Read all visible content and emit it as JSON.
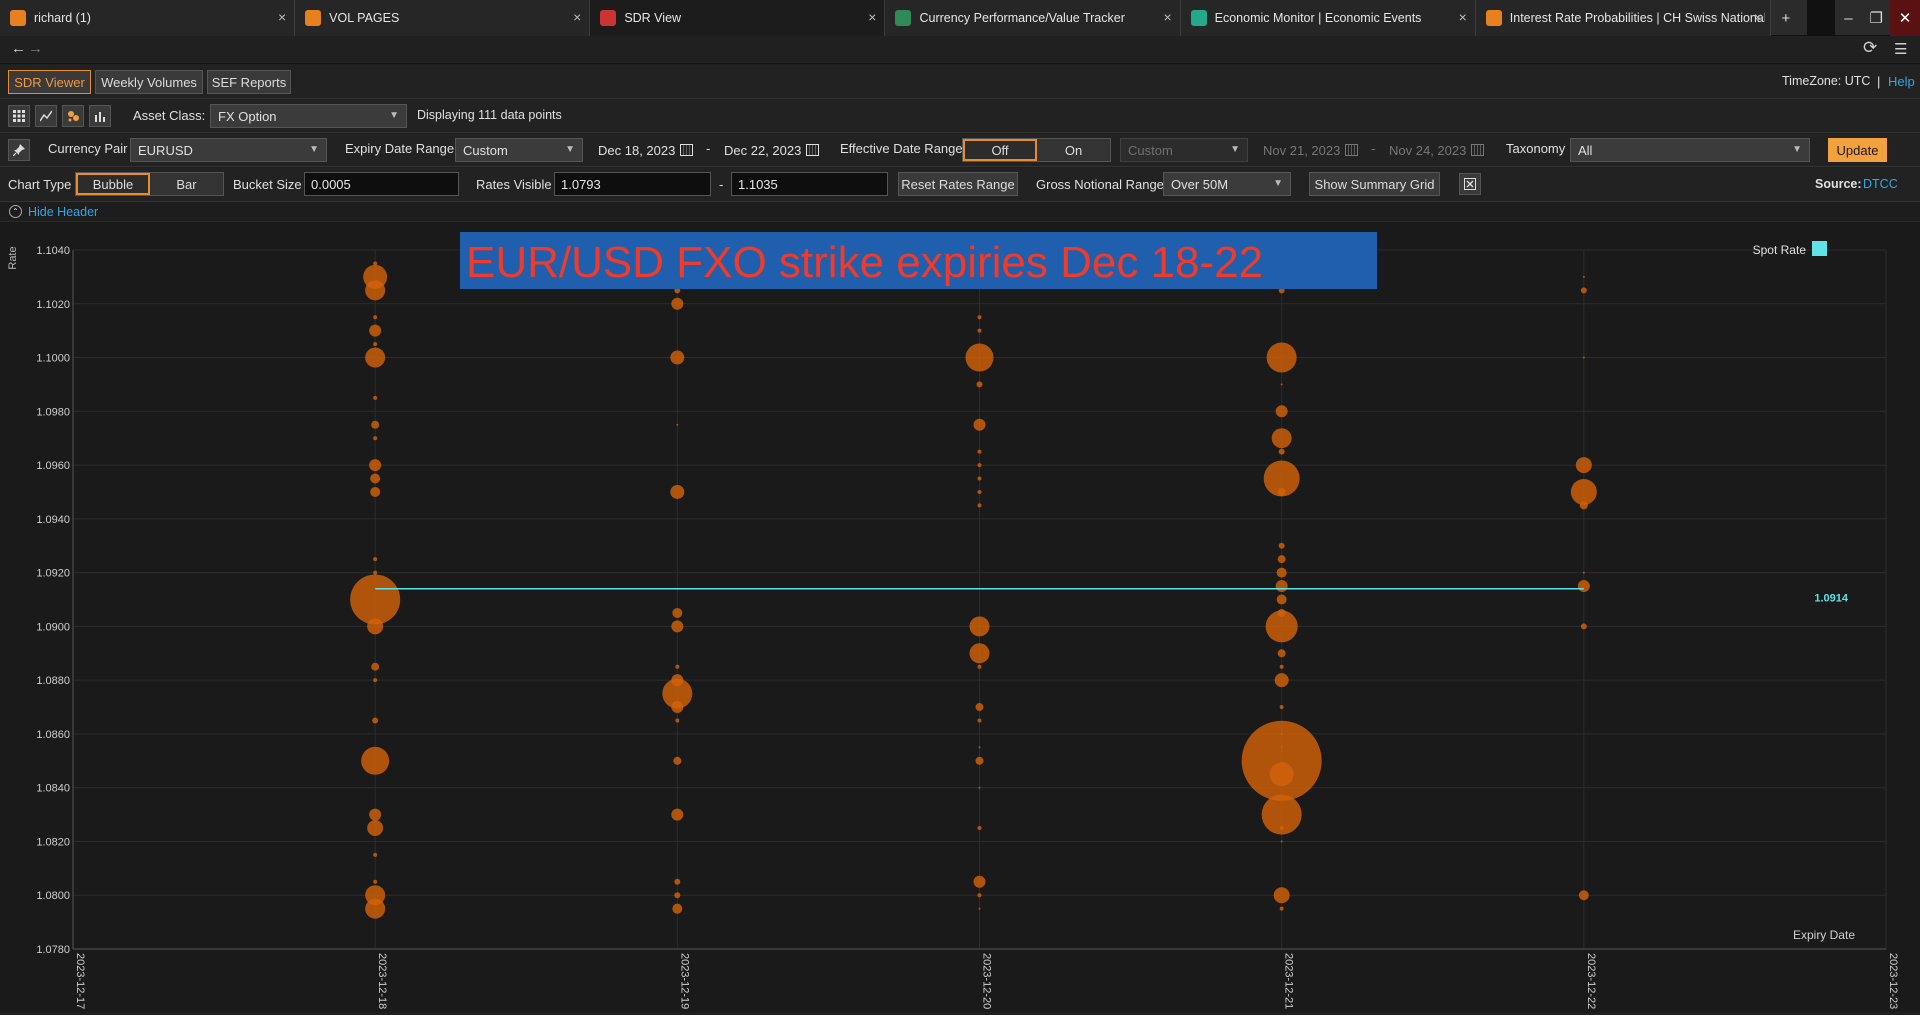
{
  "browser": {
    "tabs": [
      {
        "label": "richard (1)",
        "icon_color": "#e8801f",
        "active": false
      },
      {
        "label": "VOL PAGES",
        "icon_color": "#e8801f",
        "active": false
      },
      {
        "label": "SDR View",
        "icon_color": "#cc3333",
        "active": true
      },
      {
        "label": "Currency Performance/Value Tracker",
        "icon_color": "#2e8b57",
        "active": false
      },
      {
        "label": "Economic Monitor | Economic Events",
        "icon_color": "#22aa88",
        "active": false
      },
      {
        "label": "Interest Rate Probabilities | CH Swiss National B",
        "icon_color": "#e8801f",
        "active": false
      }
    ],
    "new_tab": "+",
    "minimize": "–",
    "restore": "❐",
    "close": "✕"
  },
  "nav": {
    "back": "←",
    "forward": "→",
    "refresh": "⟳",
    "menu": "☰"
  },
  "app_tabs": {
    "sdr_viewer": "SDR Viewer",
    "weekly_volumes": "Weekly Volumes",
    "sef_reports": "SEF Reports"
  },
  "header_right": {
    "timezone": "TimeZone: UTC",
    "separator": "|",
    "help": "Help"
  },
  "row_asset": {
    "asset_class_label": "Asset Class:",
    "asset_class_value": "FX Option",
    "displaying": "Displaying 111 data points"
  },
  "row_filters": {
    "currency_pair_label": "Currency Pair",
    "currency_pair_value": "EURUSD",
    "expiry_range_label": "Expiry Date Range",
    "expiry_range_value": "Custom",
    "expiry_from": "Dec 18, 2023",
    "dash": "-",
    "expiry_to": "Dec 22, 2023",
    "effective_label": "Effective Date Range",
    "effective_off": "Off",
    "effective_on": "On",
    "effective_value": "Custom",
    "effective_from": "Nov 21, 2023",
    "effective_to": "Nov 24, 2023",
    "taxonomy_label": "Taxonomy",
    "taxonomy_value": "All",
    "update": "Update"
  },
  "row_chart_opts": {
    "chart_type_label": "Chart Type",
    "bubble": "Bubble",
    "bar": "Bar",
    "bucket_label": "Bucket Size",
    "bucket_value": "0.0005",
    "rates_visible_label": "Rates Visible",
    "rates_min": "1.0793",
    "dash": "-",
    "rates_max": "1.1035",
    "reset_rates": "Reset Rates Range",
    "gross_notional_label": "Gross Notional Range",
    "gross_notional_value": "Over 50M",
    "summary_grid": "Show Summary Grid",
    "source_label": "Source:",
    "source_value": "DTCC"
  },
  "hide_header": "Hide Header",
  "chart_data": {
    "type": "scatter",
    "subtype": "bubble",
    "title": "EUR/USD FXO strike expiries Dec 18-22",
    "ylabel": "Rate",
    "xlabel": "Expiry Date",
    "ylim": [
      1.078,
      1.104
    ],
    "yticks": [
      "1.0780",
      "1.0800",
      "1.0820",
      "1.0840",
      "1.0860",
      "1.0880",
      "1.0900",
      "1.0920",
      "1.0940",
      "1.0960",
      "1.0980",
      "1.1000",
      "1.1020",
      "1.1040"
    ],
    "x_categories": [
      "2023-12-17",
      "2023-12-18",
      "2023-12-19",
      "2023-12-20",
      "2023-12-21",
      "2023-12-22",
      "2023-12-23"
    ],
    "legend": {
      "label": "Spot Rate",
      "position": "top-right",
      "color": "#5fe3e8"
    },
    "spot_rate": {
      "value": 1.0914,
      "label": "1.0914",
      "from": "2023-12-18",
      "to": "2023-12-22"
    },
    "bubble_color": "#d2620a",
    "series": [
      {
        "x": "2023-12-18",
        "points": [
          [
            1.1035,
            2
          ],
          [
            1.103,
            12
          ],
          [
            1.1025,
            10
          ],
          [
            1.1015,
            2
          ],
          [
            1.101,
            6
          ],
          [
            1.1005,
            2
          ],
          [
            1.1,
            10
          ],
          [
            1.0985,
            2
          ],
          [
            1.0975,
            4
          ],
          [
            1.097,
            2
          ],
          [
            1.096,
            6
          ],
          [
            1.0955,
            5
          ],
          [
            1.095,
            5
          ],
          [
            1.0925,
            2
          ],
          [
            1.092,
            2
          ],
          [
            1.091,
            25
          ],
          [
            1.09,
            8
          ],
          [
            1.0885,
            4
          ],
          [
            1.088,
            2
          ],
          [
            1.0865,
            3
          ],
          [
            1.085,
            14
          ],
          [
            1.083,
            6
          ],
          [
            1.0825,
            8
          ],
          [
            1.0815,
            2
          ],
          [
            1.0805,
            2
          ],
          [
            1.08,
            10
          ],
          [
            1.0795,
            10
          ]
        ]
      },
      {
        "x": "2023-12-19",
        "points": [
          [
            1.1025,
            3
          ],
          [
            1.102,
            6
          ],
          [
            1.1,
            7
          ],
          [
            1.0975,
            1
          ],
          [
            1.095,
            7
          ],
          [
            1.0905,
            5
          ],
          [
            1.09,
            6
          ],
          [
            1.0885,
            2
          ],
          [
            1.088,
            6
          ],
          [
            1.0875,
            15
          ],
          [
            1.087,
            6
          ],
          [
            1.0865,
            2
          ],
          [
            1.085,
            4
          ],
          [
            1.083,
            6
          ],
          [
            1.0805,
            3
          ],
          [
            1.08,
            3
          ],
          [
            1.0795,
            5
          ]
        ]
      },
      {
        "x": "2023-12-20",
        "points": [
          [
            1.1015,
            2
          ],
          [
            1.101,
            2
          ],
          [
            1.1,
            14
          ],
          [
            1.099,
            3
          ],
          [
            1.0975,
            6
          ],
          [
            1.0965,
            2
          ],
          [
            1.096,
            2
          ],
          [
            1.0955,
            2
          ],
          [
            1.095,
            2
          ],
          [
            1.0945,
            2
          ],
          [
            1.09,
            10
          ],
          [
            1.089,
            10
          ],
          [
            1.0885,
            2
          ],
          [
            1.087,
            4
          ],
          [
            1.0865,
            2
          ],
          [
            1.0855,
            1
          ],
          [
            1.085,
            4
          ],
          [
            1.084,
            1
          ],
          [
            1.0825,
            2
          ],
          [
            1.0805,
            6
          ],
          [
            1.08,
            2
          ],
          [
            1.0795,
            1
          ]
        ]
      },
      {
        "x": "2023-12-21",
        "points": [
          [
            1.103,
            1
          ],
          [
            1.1025,
            3
          ],
          [
            1.1,
            15
          ],
          [
            1.099,
            1
          ],
          [
            1.098,
            6
          ],
          [
            1.097,
            10
          ],
          [
            1.0965,
            3
          ],
          [
            1.0955,
            18
          ],
          [
            1.095,
            4
          ],
          [
            1.093,
            3
          ],
          [
            1.0925,
            4
          ],
          [
            1.092,
            5
          ],
          [
            1.0915,
            6
          ],
          [
            1.091,
            5
          ],
          [
            1.0905,
            4
          ],
          [
            1.09,
            16
          ],
          [
            1.089,
            4
          ],
          [
            1.0885,
            2
          ],
          [
            1.088,
            7
          ],
          [
            1.087,
            2
          ],
          [
            1.086,
            1
          ],
          [
            1.0855,
            1
          ],
          [
            1.085,
            40
          ],
          [
            1.0845,
            12
          ],
          [
            1.083,
            20
          ],
          [
            1.0825,
            2
          ],
          [
            1.082,
            1
          ],
          [
            1.08,
            8
          ],
          [
            1.0795,
            2
          ]
        ]
      },
      {
        "x": "2023-12-22",
        "points": [
          [
            1.103,
            1
          ],
          [
            1.1025,
            3
          ],
          [
            1.1,
            1
          ],
          [
            1.096,
            8
          ],
          [
            1.095,
            13
          ],
          [
            1.0945,
            4
          ],
          [
            1.092,
            1
          ],
          [
            1.0915,
            6
          ],
          [
            1.09,
            3
          ],
          [
            1.08,
            5
          ]
        ]
      }
    ]
  }
}
